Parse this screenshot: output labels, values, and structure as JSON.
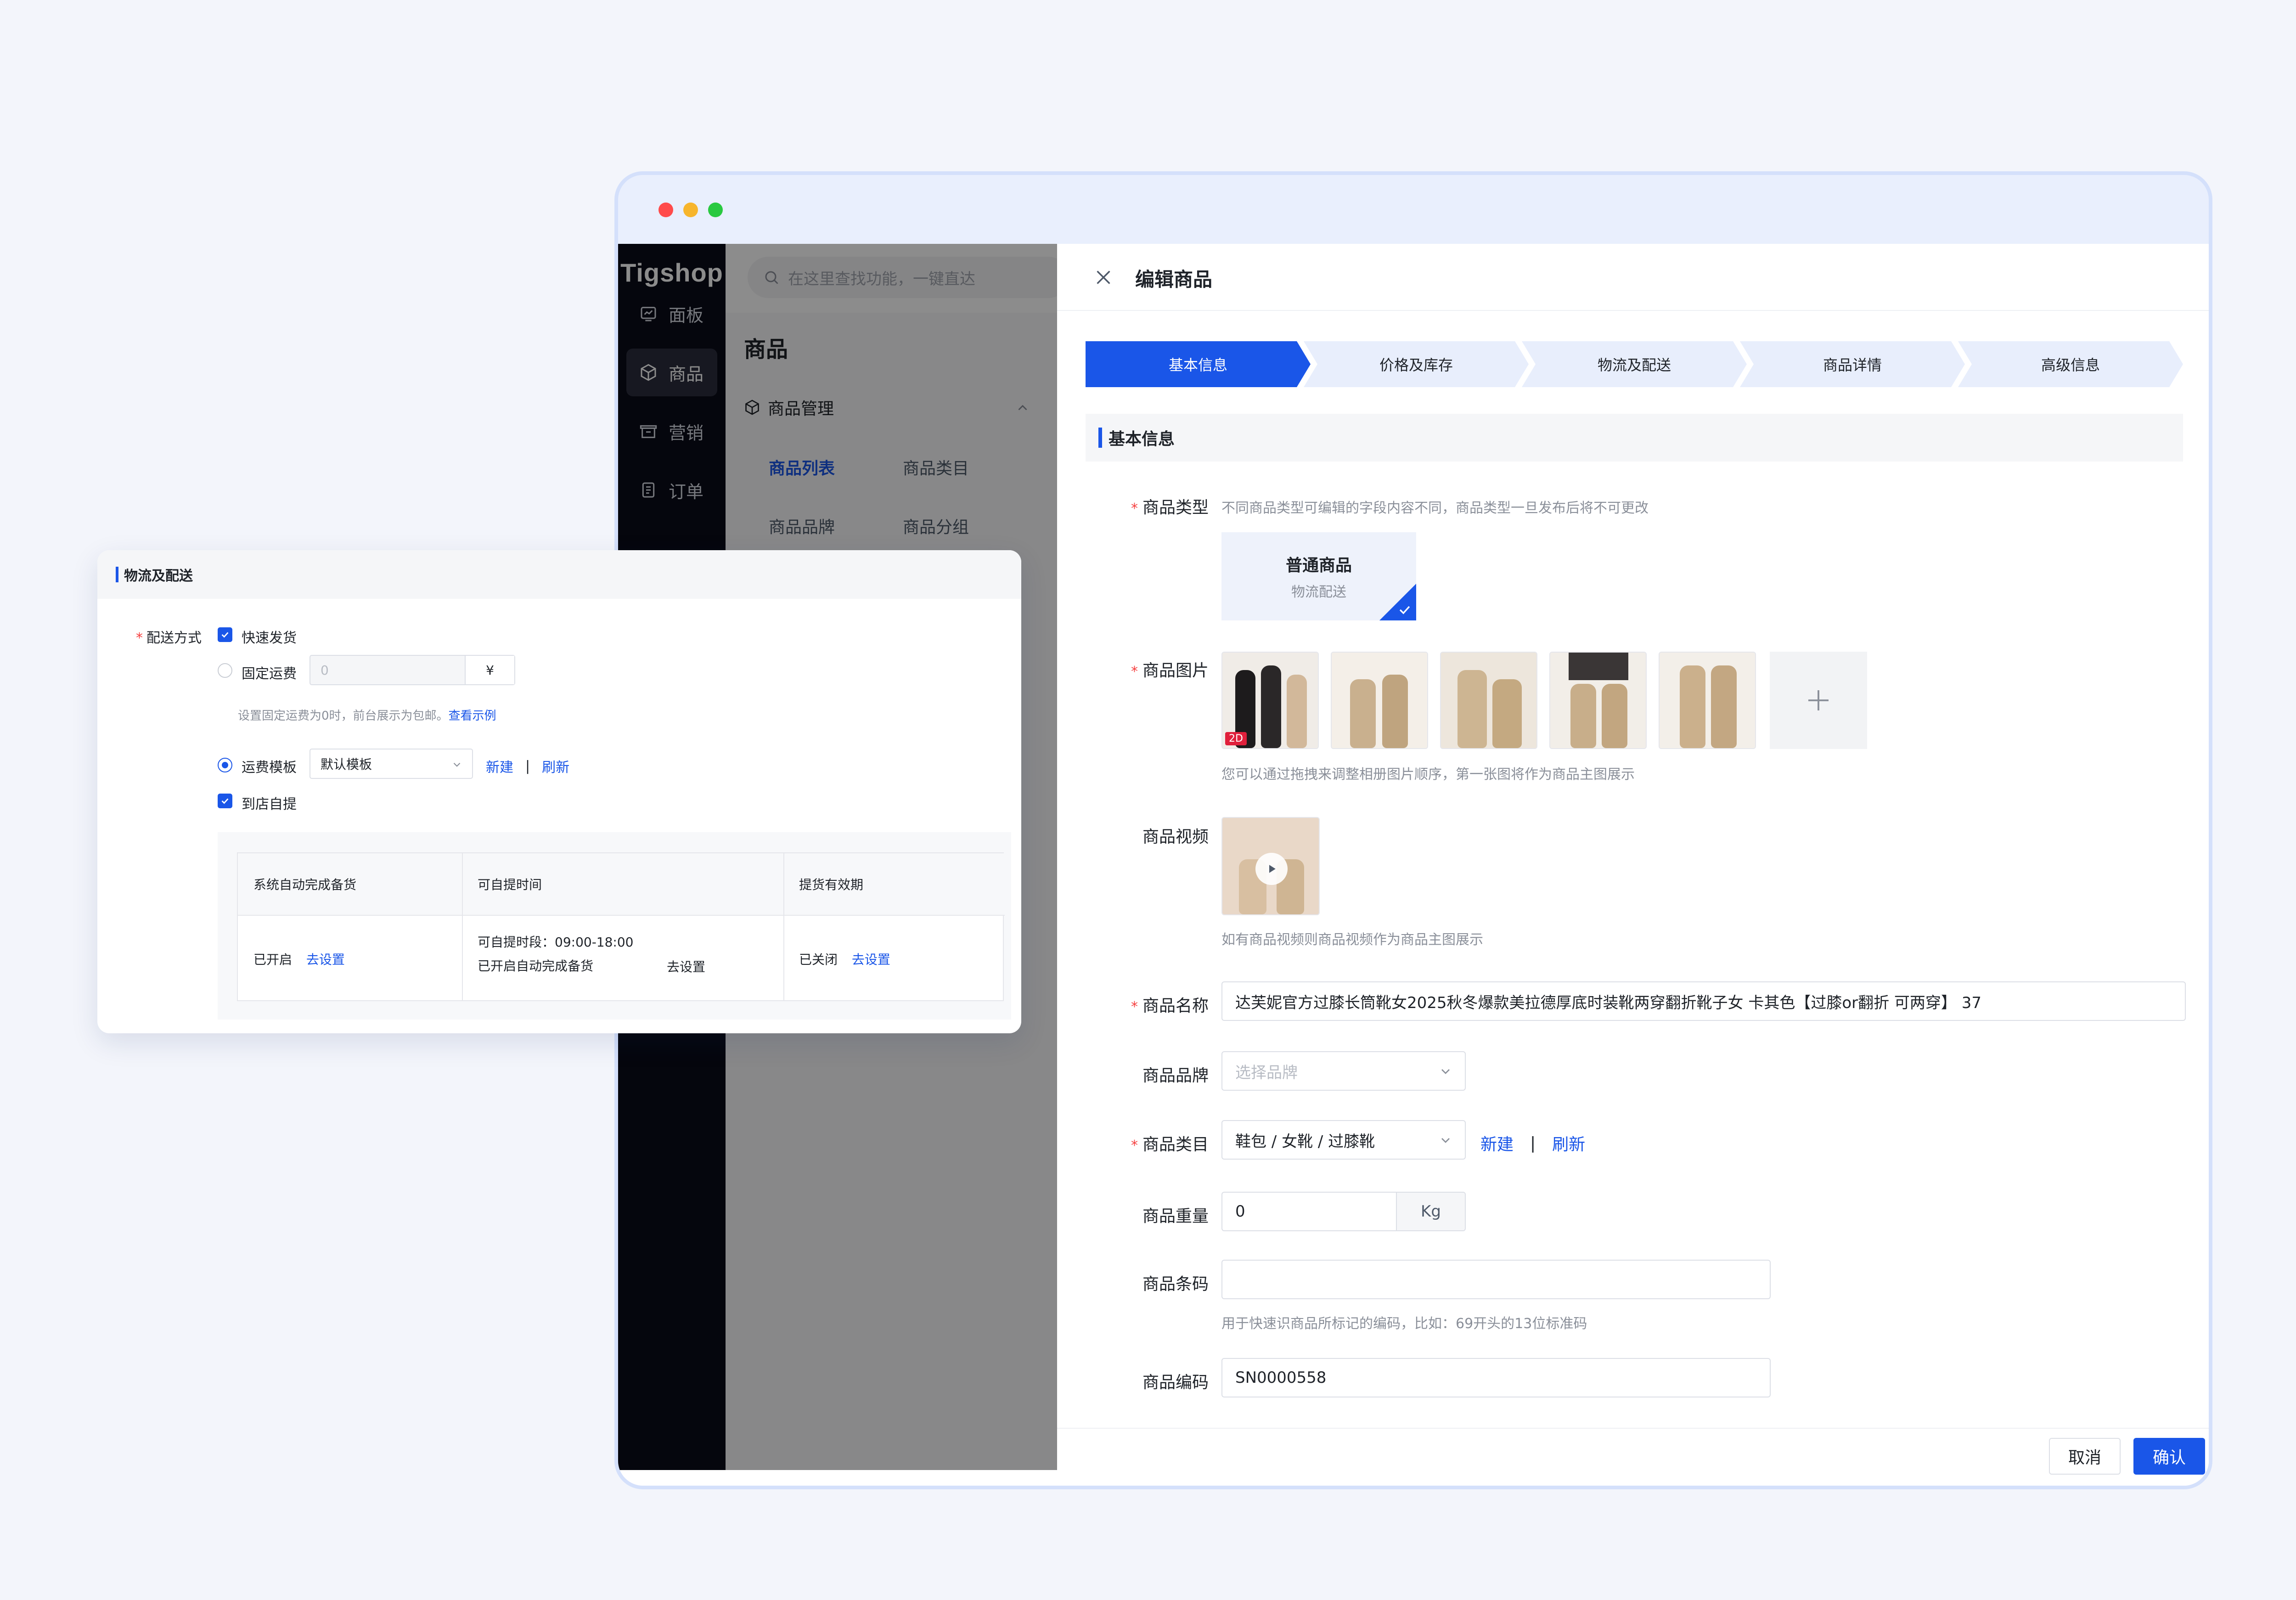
{
  "sidebar": {
    "logo": "Tigshop",
    "items": [
      {
        "label": "面板",
        "icon": "dashboard-icon"
      },
      {
        "label": "商品",
        "icon": "product-box-icon",
        "active": true
      },
      {
        "label": "营销",
        "icon": "marketing-icon"
      },
      {
        "label": "订单",
        "icon": "order-icon"
      }
    ]
  },
  "search": {
    "placeholder": "在这里查找功能，一键直达"
  },
  "subpanel": {
    "title": "商品",
    "group": "商品管理",
    "links": [
      "商品列表",
      "商品类目",
      "商品品牌",
      "商品分组"
    ]
  },
  "drawer": {
    "title": "编辑商品",
    "steps": [
      "基本信息",
      "价格及库存",
      "物流及配送",
      "商品详情",
      "高级信息"
    ],
    "section": "基本信息",
    "fields": {
      "type_label": "商品类型",
      "type_help": "不同商品类型可编辑的字段内容不同，商品类型一旦发布后将不可更改",
      "type_card_title": "普通商品",
      "type_card_sub": "物流配送",
      "images_label": "商品图片",
      "images_help": "您可以通过拖拽来调整相册图片顺序，第一张图将作为商品主图展示",
      "video_label": "商品视频",
      "video_help": "如有商品视频则商品视频作为商品主图展示",
      "name_label": "商品名称",
      "name_value": "达芙妮官方过膝长筒靴女2025秋冬爆款美拉德厚底时装靴两穿翻折靴子女 卡其色【过膝or翻折 可两穿】 37",
      "brand_label": "商品品牌",
      "brand_placeholder": "选择品牌",
      "category_label": "商品类目",
      "category_value": "鞋包 / 女靴 / 过膝靴",
      "category_new": "新建",
      "category_refresh": "刷新",
      "link_sep": "|",
      "weight_label": "商品重量",
      "weight_value": "0",
      "weight_unit": "Kg",
      "barcode_label": "商品条码",
      "barcode_help": "用于快速识商品所标记的编码，比如：69开头的13位标准码",
      "sn_label": "商品编码",
      "sn_value": "SN0000558",
      "thumb_badge": "2D"
    },
    "cancel": "取消",
    "confirm": "确认"
  },
  "logistics": {
    "title": "物流及配送",
    "method_label": "配送方式",
    "express": "快速发货",
    "fixed_fee": "固定运费",
    "fixed_fee_value": "0",
    "currency": "¥",
    "fixed_help": "设置固定运费为0时，前台展示为包邮。",
    "fixed_help_link": "查看示例",
    "template_label": "运费模板",
    "template_value": "默认模板",
    "template_new": "新建",
    "template_refresh": "刷新",
    "sep": "|",
    "pickup": "到店自提",
    "table": {
      "headers": [
        "系统自动完成备货",
        "可自提时间",
        "提货有效期"
      ],
      "col1_status": "已开启",
      "col1_link": "去设置",
      "col2_line1": "可自提时段：09:00-18:00",
      "col2_line2": "已开启自动完成备货",
      "col2_link": "去设置",
      "col3_status": "已关闭",
      "col3_link": "去设置"
    }
  },
  "colors": {
    "accent": "#1a56e8",
    "sidebar": "#0a0c18",
    "required": "#f53f3f"
  }
}
